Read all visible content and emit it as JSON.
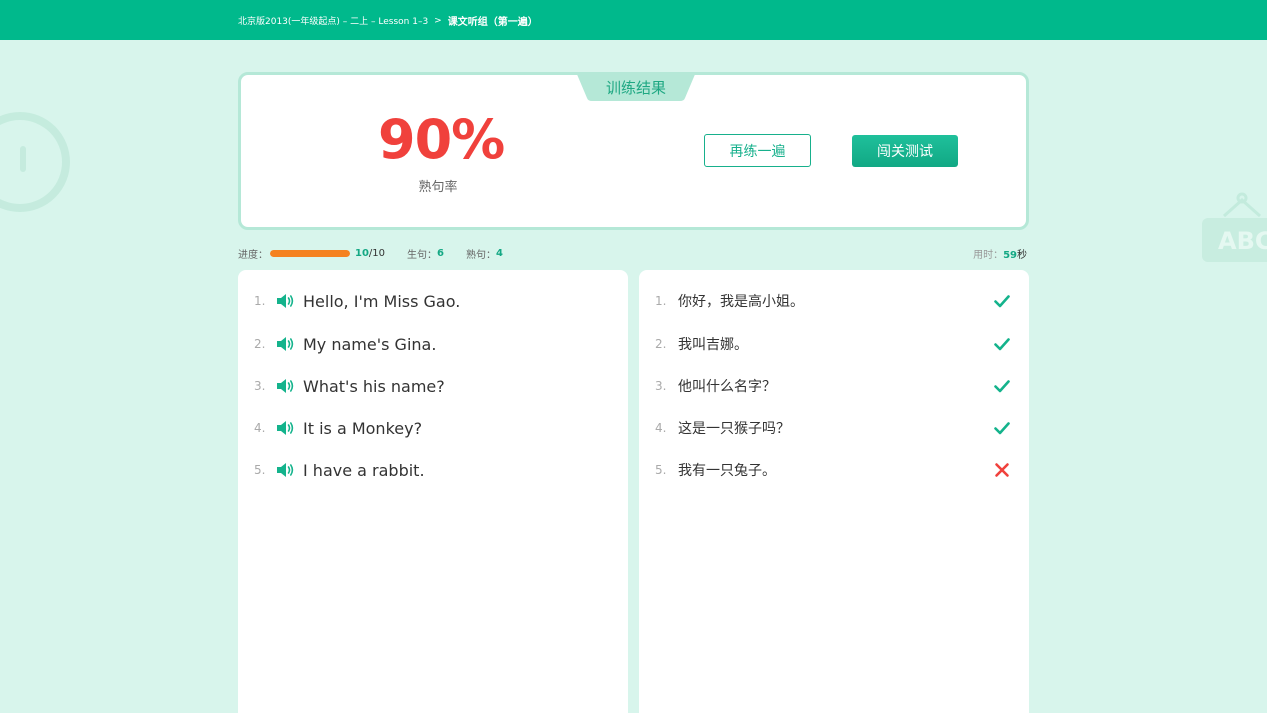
{
  "header": {
    "breadcrumb_path": "北京版2013(一年级起点) – 二上 – Lesson 1–3",
    "breadcrumb_sep": ">",
    "breadcrumb_current": "课文听组（第一遍）"
  },
  "decor": {
    "abc_text": "ABC"
  },
  "result": {
    "tab_title": "训练结果",
    "score": "90%",
    "score_label": "熟句率",
    "retry_label": "再练一遍",
    "test_label": "闯关测试"
  },
  "stats": {
    "progress_label": "进度：",
    "progress_done": "10",
    "progress_total": "/10",
    "progress_fraction": 1.0,
    "new_label": "生句：",
    "new_count": "6",
    "familiar_label": "熟句：",
    "familiar_count": "4",
    "time_label": "用时：",
    "time_value": "59",
    "time_unit": "秒"
  },
  "sentences": [
    {
      "index": "1.",
      "en": "Hello, I'm Miss Gao.",
      "cn": "你好，我是高小姐。",
      "correct": true
    },
    {
      "index": "2.",
      "en": "My name's Gina.",
      "cn": "我叫吉娜。",
      "correct": true
    },
    {
      "index": "3.",
      "en": "What's his name?",
      "cn": "他叫什么名字？",
      "correct": true
    },
    {
      "index": "4.",
      "en": "It is a Monkey?",
      "cn": "这是一只猴子吗？",
      "correct": true
    },
    {
      "index": "5.",
      "en": "I have a rabbit.",
      "cn": "我有一只兔子。",
      "correct": false
    }
  ],
  "colors": {
    "brand": "#00b98c",
    "score": "#f0413c",
    "progress": "#f58220",
    "correct": "#14b38c",
    "wrong": "#f0413c"
  },
  "icons": {
    "play": "speaker-icon",
    "correct": "check-icon",
    "wrong": "cross-icon"
  }
}
